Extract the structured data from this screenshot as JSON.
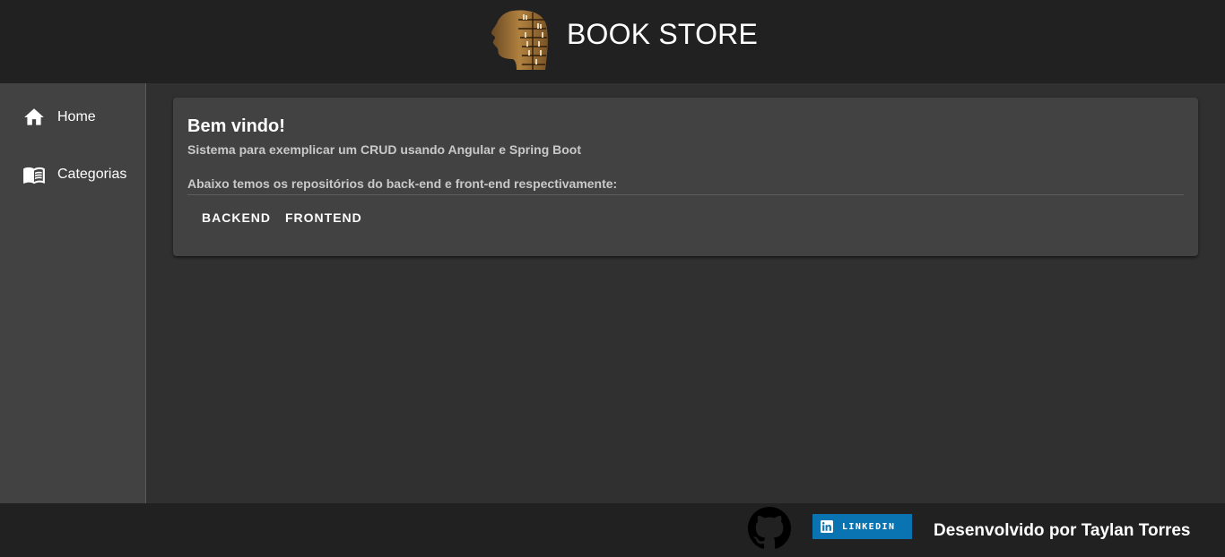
{
  "header": {
    "title": "BOOK STORE",
    "logo_icon": "head-bookshelf-logo"
  },
  "sidebar": {
    "items": [
      {
        "label": "Home",
        "icon": "home-icon"
      },
      {
        "label": "Categorias",
        "icon": "book-icon"
      }
    ]
  },
  "card": {
    "title": "Bem vindo!",
    "subtitle": "Sistema para exemplicar um CRUD usando Angular e Spring Boot",
    "text": "Abaixo temos os repositórios do back-end e front-end respectivamente:",
    "actions": [
      {
        "label": "BACKEND"
      },
      {
        "label": "FRONTEND"
      }
    ]
  },
  "footer": {
    "github_icon": "github-icon",
    "linkedin_label": "LINKEDIN",
    "credit": "Desenvolvido por Taylan Torres"
  },
  "colors": {
    "header_bg": "#212121",
    "sidebar_bg": "#424242",
    "page_bg": "#303030",
    "card_bg": "#424242",
    "linkedin_blue": "#0a73b1"
  }
}
